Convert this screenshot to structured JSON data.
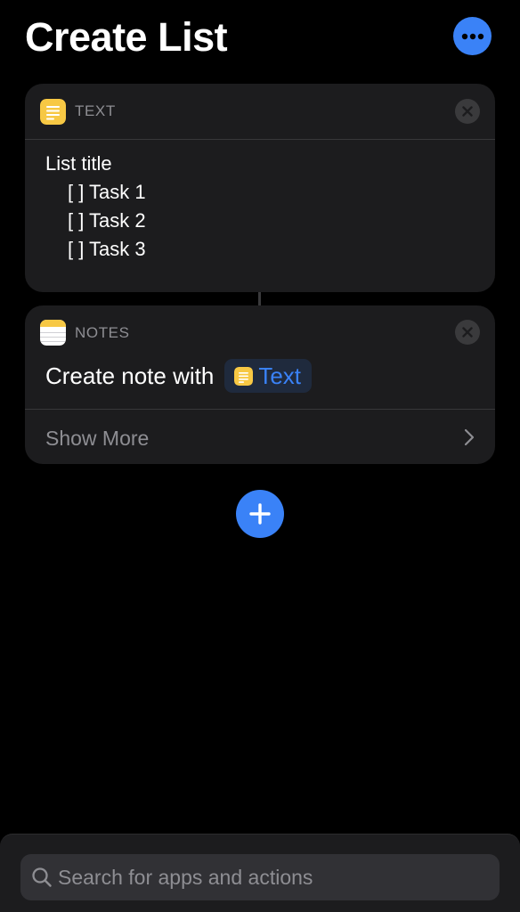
{
  "page": {
    "title": "Create List"
  },
  "colors": {
    "accent": "#3a82f7",
    "card": "#1c1c1e",
    "secondary_text": "#8e8e93"
  },
  "actions": [
    {
      "app_label": "TEXT",
      "icon": "text-app-icon",
      "lines": [
        "List title",
        "[ ] Task 1",
        "[ ] Task 2",
        "[ ] Task 3"
      ]
    },
    {
      "app_label": "NOTES",
      "icon": "notes-app-icon",
      "action_text": "Create note with",
      "token_label": "Text",
      "show_more_label": "Show More"
    }
  ],
  "search": {
    "placeholder": "Search for apps and actions",
    "value": ""
  }
}
